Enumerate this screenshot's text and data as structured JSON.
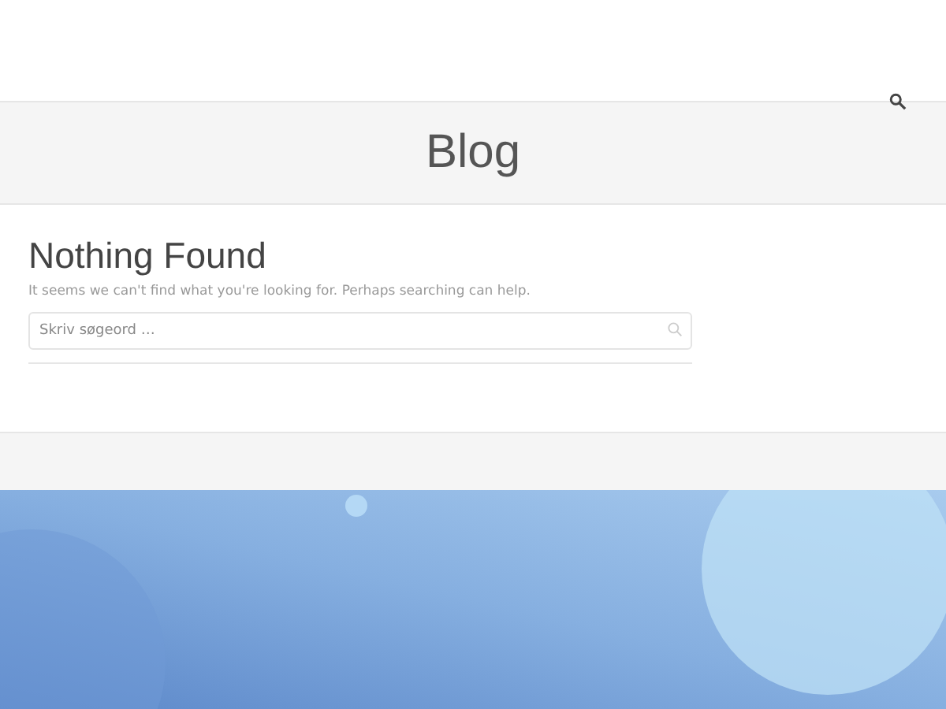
{
  "page_title": "Blog",
  "content": {
    "heading": "Nothing Found",
    "message": "It seems we can't find what you're looking for. Perhaps searching can help.",
    "search": {
      "placeholder": "Skriv søgeord …"
    }
  }
}
